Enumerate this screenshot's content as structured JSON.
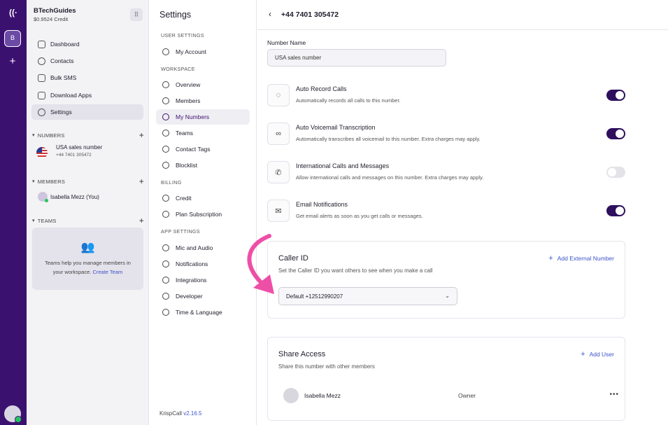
{
  "rail": {
    "logo": "((·",
    "workspace_initial": "B",
    "add_label": "+"
  },
  "workspace": {
    "name": "BTechGuides",
    "credit": "$0.9524 Credit",
    "dialpad_icon": "dialpad-icon"
  },
  "sidebar": {
    "nav": [
      {
        "label": "Dashboard",
        "icon": "dashboard-icon"
      },
      {
        "label": "Contacts",
        "icon": "contacts-icon"
      },
      {
        "label": "Bulk SMS",
        "icon": "sms-icon"
      },
      {
        "label": "Download Apps",
        "icon": "phone-icon"
      },
      {
        "label": "Settings",
        "icon": "gear-icon",
        "active": true
      }
    ],
    "numbers_head": "NUMBERS",
    "number": {
      "name": "USA sales number",
      "phone": "+44 7401 305472"
    },
    "members_head": "MEMBERS",
    "member": "Isabella Mezz (You)",
    "teams_head": "TEAMS",
    "teams_text": "Teams help you manage members in your workspace.",
    "teams_link": "Create Team"
  },
  "settings": {
    "title": "Settings",
    "sections": {
      "user": "USER SETTINGS",
      "workspace": "WORKSPACE",
      "billing": "BILLING",
      "app": "APP SETTINGS"
    },
    "items": {
      "my_account": "My Account",
      "overview": "Overview",
      "members": "Members",
      "my_numbers": "My Numbers",
      "teams": "Teams",
      "contact_tags": "Contact Tags",
      "blocklist": "Blocklist",
      "credit": "Credit",
      "plan": "Plan Subscription",
      "mic": "Mic and Audio",
      "notifications": "Notifications",
      "integrations": "Integrations",
      "developer": "Developer",
      "time": "Time & Language"
    },
    "version_prefix": "KrispCall",
    "version": "v2.16.5"
  },
  "main": {
    "title": "+44 7401 305472",
    "number_name_label": "Number Name",
    "number_name_value": "USA sales number",
    "toggles": [
      {
        "title": "Auto Record Calls",
        "desc": "Automatically records all calls to this number.",
        "on": true
      },
      {
        "title": "Auto Voicemail Transcription",
        "desc": "Automatically transcribes all voicemail to this number. Extra charges may apply.",
        "on": true
      },
      {
        "title": "International Calls and Messages",
        "desc": "Allow international calls and messages on this number. Extra charges may apply.",
        "on": false
      },
      {
        "title": "Email Notifications",
        "desc": "Get email alerts as soon as you get calls or messages.",
        "on": true
      }
    ],
    "caller_id": {
      "title": "Caller ID",
      "desc": "Set the Caller ID you want others to see when you make a call",
      "action": "Add External Number",
      "selected": "Default +12512990207"
    },
    "share": {
      "title": "Share Access",
      "desc": "Share this number with other members",
      "action": "Add User",
      "user": {
        "name": "Isabella Mezz",
        "role": "Owner"
      }
    }
  },
  "colors": {
    "rail": "#3b1170",
    "accent": "#3d54c9",
    "toggle_on": "#2d0f5e",
    "annotation_arrow": "#ee4fa6"
  }
}
